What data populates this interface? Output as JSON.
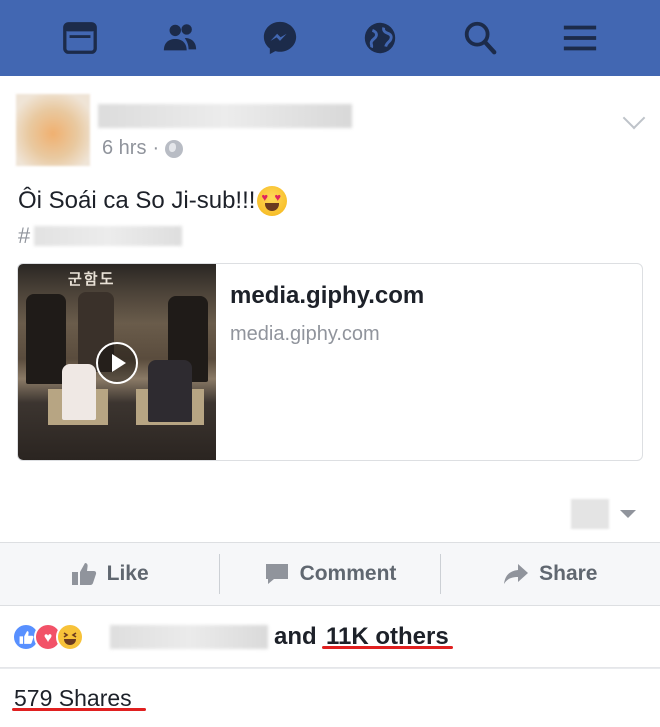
{
  "nav": {
    "items": [
      {
        "name": "news-feed-icon"
      },
      {
        "name": "friends-icon"
      },
      {
        "name": "messenger-icon"
      },
      {
        "name": "notifications-globe-icon"
      },
      {
        "name": "search-icon"
      },
      {
        "name": "menu-icon"
      }
    ],
    "color": "#4267b2"
  },
  "post": {
    "timestamp": "6 hrs",
    "separator": "·",
    "text": "Ôi Soái ca So Ji-sub!!!",
    "hashtag_prefix": "#",
    "link": {
      "title": "media.giphy.com",
      "domain": "media.giphy.com",
      "thumbnail_title": "군함도"
    }
  },
  "actions": {
    "like": "Like",
    "comment": "Comment",
    "share": "Share"
  },
  "reactions": {
    "and_text": "and",
    "count_text": "11K others"
  },
  "shares": {
    "text": "579 Shares"
  },
  "colors": {
    "highlight_underline": "#e02020",
    "like_reaction": "#5890ff",
    "love_reaction": "#f25268",
    "haha_reaction": "#f7c239"
  }
}
